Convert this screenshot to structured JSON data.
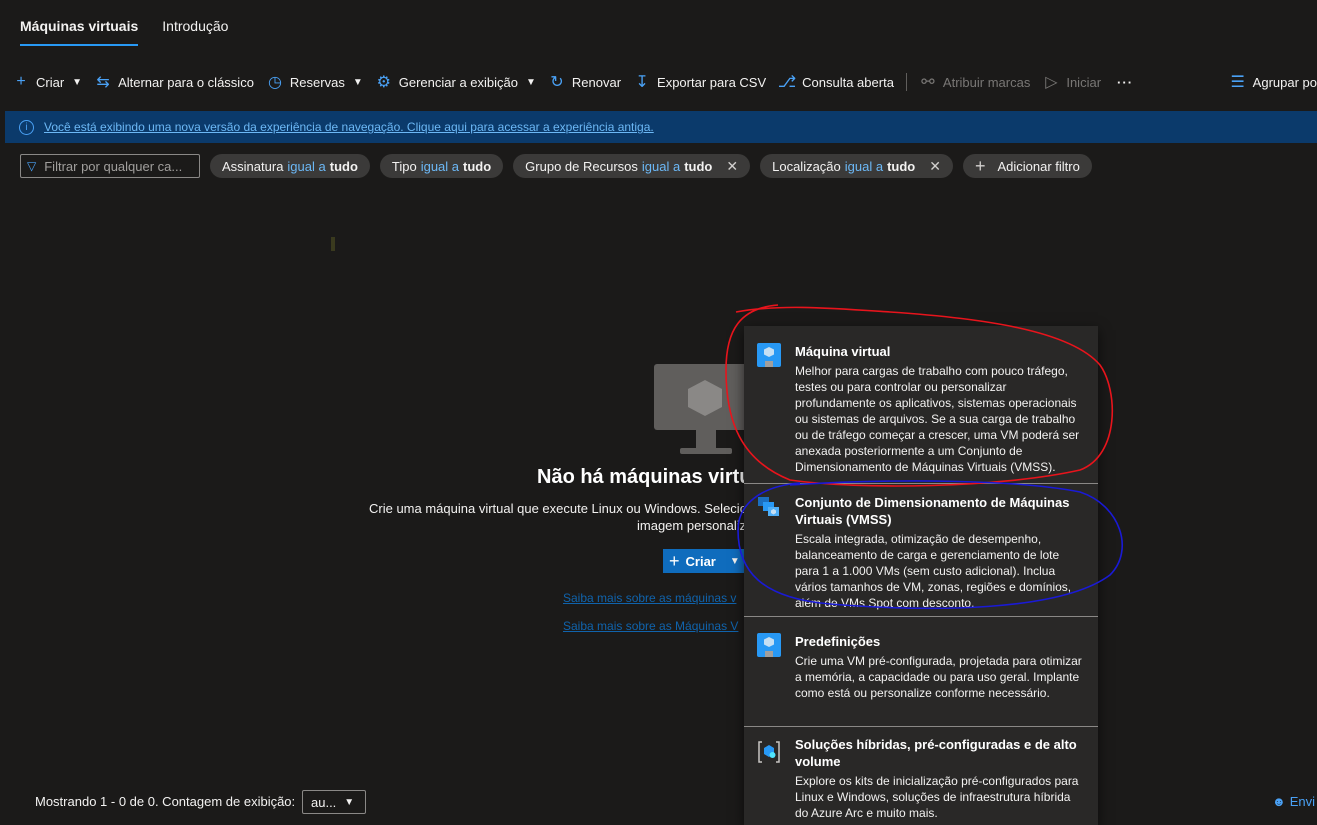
{
  "tabs": [
    {
      "label": "Máquinas virtuais",
      "active": true
    },
    {
      "label": "Introdução",
      "active": false
    }
  ],
  "toolbar": {
    "create": "Criar",
    "switch_classic": "Alternar para o clássico",
    "reservations": "Reservas",
    "manage_view": "Gerenciar a exibição",
    "refresh": "Renovar",
    "export_csv": "Exportar para CSV",
    "open_query": "Consulta aberta",
    "assign_tags": "Atribuir marcas",
    "start": "Iniciar",
    "more": "···",
    "group_by": "Agrupar po"
  },
  "banner": {
    "text": "Você está exibindo uma nova versão da experiência de navegação. Clique aqui para acessar a experiência antiga."
  },
  "filters": {
    "placeholder": "Filtrar por qualquer ca...",
    "pills": [
      {
        "name": "Assinatura",
        "op": "igual a",
        "value": "tudo",
        "removable": false
      },
      {
        "name": "Tipo",
        "op": "igual a",
        "value": "tudo",
        "removable": false
      },
      {
        "name": "Grupo de Recursos",
        "op": "igual a",
        "value": "tudo",
        "removable": true
      },
      {
        "name": "Localização",
        "op": "igual a",
        "value": "tudo",
        "removable": true
      }
    ],
    "add_filter": "Adicionar filtro"
  },
  "empty_state": {
    "title": "Não há máquinas virtu",
    "desc_line1": "Crie uma máquina virtual que execute Linux ou Windows. Selecion",
    "desc_line2": "imagem personaliz",
    "create_button": "Criar",
    "learn_more_1": "Saiba mais sobre as máquinas v",
    "learn_more_2": "Saiba mais sobre as Máquinas V"
  },
  "create_menu": {
    "items": [
      {
        "title": "Máquina virtual",
        "desc": "Melhor para cargas de trabalho com pouco tráfego, testes ou para controlar ou personalizar profundamente os aplicativos, sistemas operacionais ou sistemas de arquivos. Se a sua carga de trabalho ou de tráfego começar a crescer, uma VM poderá ser anexada posteriormente a um Conjunto de Dimensionamento de Máquinas Virtuais (VMSS)."
      },
      {
        "title": "Conjunto de Dimensionamento de Máquinas Virtuais (VMSS)",
        "desc": "Escala integrada, otimização de desempenho, balanceamento de carga e gerenciamento de lote para 1 a 1.000 VMs (sem custo adicional). Inclua vários tamanhos de VM, zonas, regiões e domínios, além de VMs Spot com desconto."
      },
      {
        "title": "Predefinições",
        "desc": "Crie uma VM pré-configurada, projetada para otimizar a memória, a capacidade ou para uso geral. Implante como está ou personalize conforme necessário."
      },
      {
        "title": "Soluções híbridas, pré-configuradas e de alto volume",
        "desc": "Explore os kits de inicialização pré-configurados para Linux e Windows, soluções de infraestrutura híbrida do Azure Arc e muito mais."
      }
    ]
  },
  "footer": {
    "showing": "Mostrando 1 - 0 de 0. Contagem de exibição:",
    "count_value": "au...",
    "feedback": "Envi"
  },
  "colors": {
    "accent": "#2899f5",
    "annotation_red": "#e8141c",
    "annotation_blue": "#1a1ad6"
  }
}
